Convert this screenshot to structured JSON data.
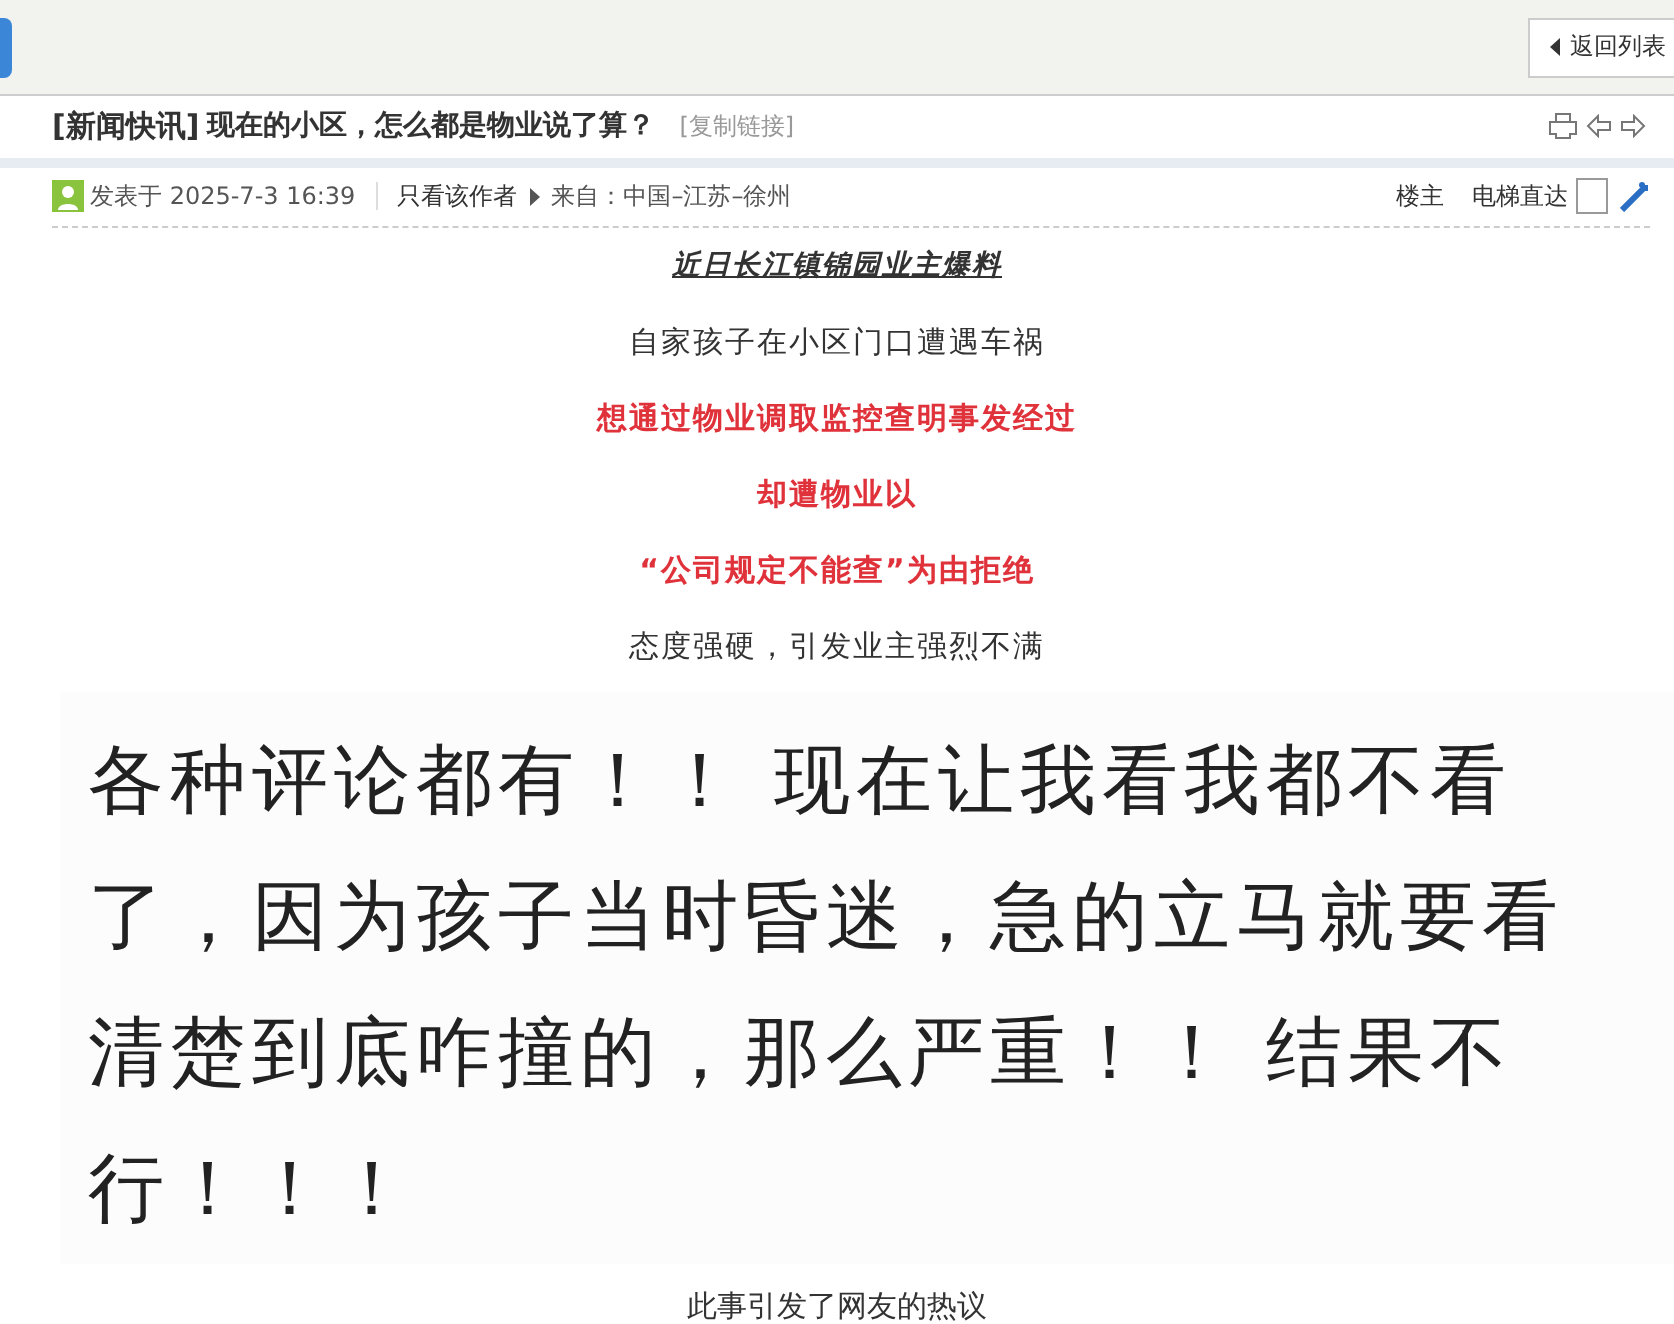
{
  "toolbar": {
    "back_button": "返回列表"
  },
  "thread": {
    "category": "[新闻快讯]",
    "title": "现在的小区，怎么都是物业说了算？",
    "copy_link": "[复制链接]"
  },
  "post_info": {
    "posted": "发表于 2025-7-3 16:39",
    "author_only": "只看该作者",
    "from": "来自：中国–江苏–徐州",
    "floor": "楼主",
    "jump": "电梯直达"
  },
  "content": [
    {
      "kind": "heading",
      "text": "近日长江镇锦园业主爆料"
    },
    {
      "kind": "plain",
      "text": "自家孩子在小区门口遭遇车祸"
    },
    {
      "kind": "alert",
      "text": "想通过物业调取监控查明事发经过"
    },
    {
      "kind": "alert",
      "text": "却遭物业以"
    },
    {
      "kind": "alert",
      "text": "“公司规定不能查”为由拒绝"
    },
    {
      "kind": "plain",
      "text": "态度强硬，引发业主强烈不满"
    }
  ],
  "screenshot_lines": [
    "各种评论都有！！ 现在让我看我都不看",
    "了，因为孩子当时昏迷，急的立马就要看",
    "清楚到底咋撞的，那么严重！！ 结果不",
    "行！！！"
  ],
  "footer_line": "此事引发了网友的热议"
}
